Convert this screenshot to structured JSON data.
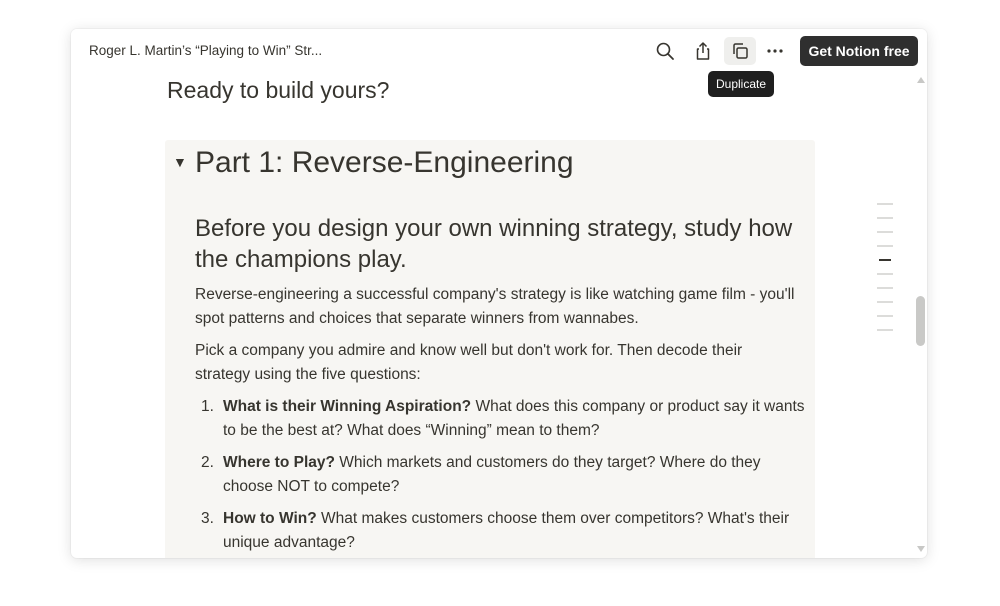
{
  "topbar": {
    "breadcrumb": "Roger L. Martin’s “Playing to Win” Str...",
    "search_icon": "search-icon",
    "share_icon": "share-icon",
    "duplicate_icon": "duplicate-icon",
    "more_icon": "more-horizontal-icon",
    "cta_label": "Get Notion free",
    "tooltip": "Duplicate"
  },
  "content": {
    "ready_heading": "Ready to build yours?",
    "toggle_icon": "caret-down-icon",
    "part_title": "Part 1: Reverse-Engineering",
    "subheading": "Before you design your own winning strategy, study how the champions play.",
    "paragraph1": "Reverse-engineering a successful company's strategy is like watching game film - you'll spot patterns and choices that separate winners from wannabes.",
    "paragraph2": "Pick a company you admire and know well but don't work for. Then decode their strategy using the five questions:",
    "list": [
      {
        "num": "1.",
        "bold": "What is their Winning Aspiration?",
        "text": " What does this company or product say it wants to be the best at? What does “Winning” mean to them?"
      },
      {
        "num": "2.",
        "bold": "Where to Play?",
        "text": " Which markets and customers do they target? Where do they choose NOT to compete?"
      },
      {
        "num": "3.",
        "bold": "How to Win?",
        "text": " What makes customers choose them over competitors? What's their unique advantage?"
      }
    ]
  },
  "colors": {
    "text": "#37352f",
    "callout_bg": "#f7f6f3",
    "cta_bg": "#2f2f2f",
    "tooltip_bg": "#1f1f1f"
  }
}
